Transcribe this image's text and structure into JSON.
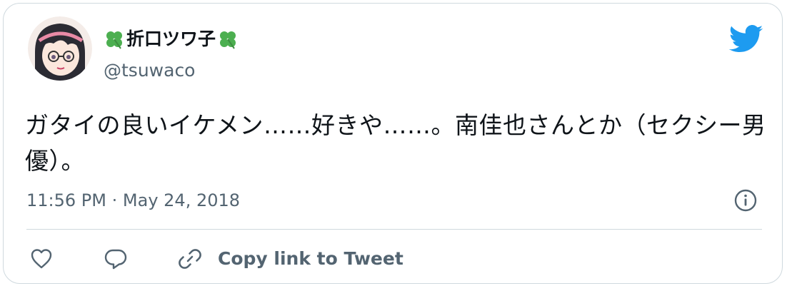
{
  "author": {
    "display_name": "折口ツワ子",
    "handle": "@tsuwaco"
  },
  "tweet": {
    "text": "ガタイの良いイケメン……好きや……。南佳也さんとか（セクシー男優）。",
    "time": "11:56 PM",
    "separator": "·",
    "date": "May 24, 2018"
  },
  "actions": {
    "copy_link_label": "Copy link to Tweet"
  },
  "colors": {
    "twitter_blue": "#1d9bf0",
    "secondary_text": "#536471",
    "clover_green": "#4caf50"
  },
  "icons": [
    "clover-icon",
    "twitter-bird-icon",
    "info-icon",
    "heart-icon",
    "reply-icon",
    "link-icon"
  ]
}
